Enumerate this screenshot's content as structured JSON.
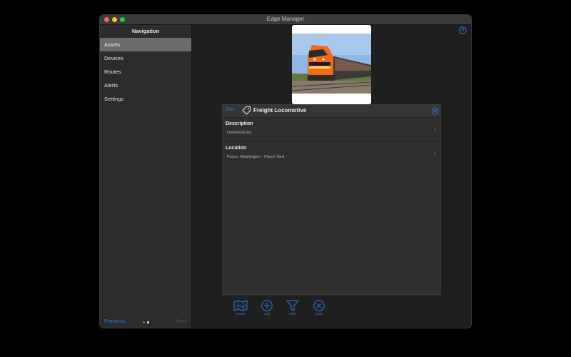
{
  "window": {
    "title": "Edge Manager"
  },
  "sidebar": {
    "header": "Navigation",
    "items": [
      {
        "label": "Assets",
        "selected": true
      },
      {
        "label": "Devices",
        "selected": false
      },
      {
        "label": "Routes",
        "selected": false
      },
      {
        "label": "Alerts",
        "selected": false
      },
      {
        "label": "Settings",
        "selected": false
      }
    ],
    "footer": {
      "previous": "Previous",
      "next": "Next",
      "page_count": 2,
      "current_page": 2
    }
  },
  "asset": {
    "edit_label": "Edit",
    "name": "Freight Locomotive",
    "icon": "tag-icon",
    "fields": [
      {
        "label": "Description",
        "value": "Diesel-Electric"
      },
      {
        "label": "Location",
        "value": "Pasco, Washington - Pasco Yard"
      }
    ]
  },
  "toolbar": {
    "buttons": [
      {
        "label": "Routes",
        "icon": "map-icon"
      },
      {
        "label": "Add",
        "icon": "plus-circle-icon"
      },
      {
        "label": "Filter",
        "icon": "filter-icon"
      },
      {
        "label": "Close",
        "icon": "close-circle-icon"
      }
    ]
  },
  "colors": {
    "accent": "#2a7fe0",
    "locomotive_body": "#f26a1b",
    "sky": "#8fb7e6"
  }
}
